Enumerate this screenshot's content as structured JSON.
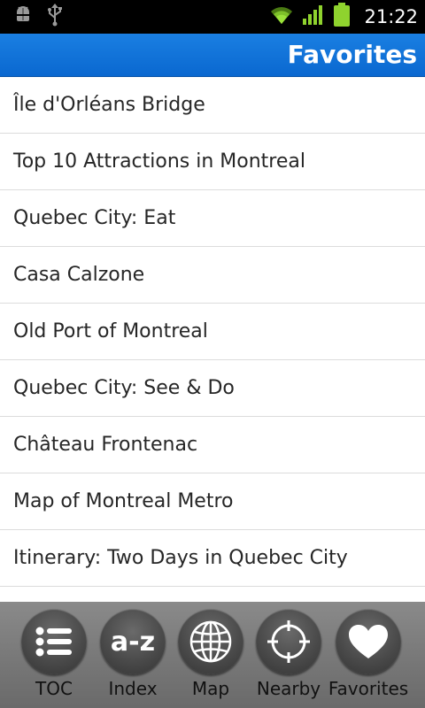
{
  "status_bar": {
    "time": "21:22",
    "icons": [
      "android-debug-icon",
      "usb-icon",
      "wifi-icon",
      "signal-icon",
      "battery-icon"
    ]
  },
  "header": {
    "title": "Favorites",
    "color": "#0a6fd6"
  },
  "favorites": [
    "Île d'Orléans Bridge",
    "Top 10 Attractions in Montreal",
    "Quebec City: Eat",
    "Casa Calzone",
    "Old Port of Montreal",
    "Quebec City: See & Do",
    "Château Frontenac",
    "Map of Montreal Metro",
    "Itinerary: Two Days in Quebec City",
    ""
  ],
  "toolbar": {
    "items": [
      {
        "label": "TOC",
        "icon": "list-icon"
      },
      {
        "label": "Index",
        "icon": "a-z-icon",
        "glyph": "a-z"
      },
      {
        "label": "Map",
        "icon": "globe-icon"
      },
      {
        "label": "Nearby",
        "icon": "crosshair-icon"
      },
      {
        "label": "Favorites",
        "icon": "heart-icon"
      }
    ]
  }
}
